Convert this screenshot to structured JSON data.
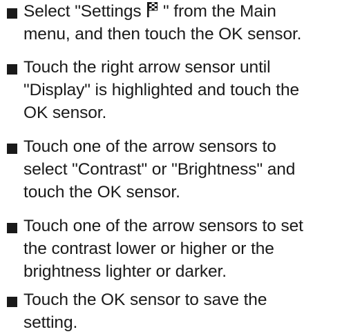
{
  "instructions": {
    "steps": [
      {
        "lines": [
          [
            "Select \"Settings ",
            " \" from the Main"
          ],
          "menu, and then touch the OK sensor."
        ]
      },
      {
        "lines": [
          "Touch the right arrow sensor until",
          "\"Display\" is highlighted and touch the",
          "OK sensor."
        ]
      },
      {
        "lines": [
          "Touch one of the arrow sensors to",
          "select \"Contrast\" or \"Brightness\" and",
          "touch the OK sensor."
        ]
      },
      {
        "lines": [
          "Touch one of the arrow sensors to set",
          "the contrast lower or higher or the",
          "brightness lighter or darker."
        ]
      },
      {
        "lines": [
          "Touch the OK sensor to save the",
          "setting."
        ]
      }
    ],
    "settings_icon": "settings-flag-icon"
  }
}
